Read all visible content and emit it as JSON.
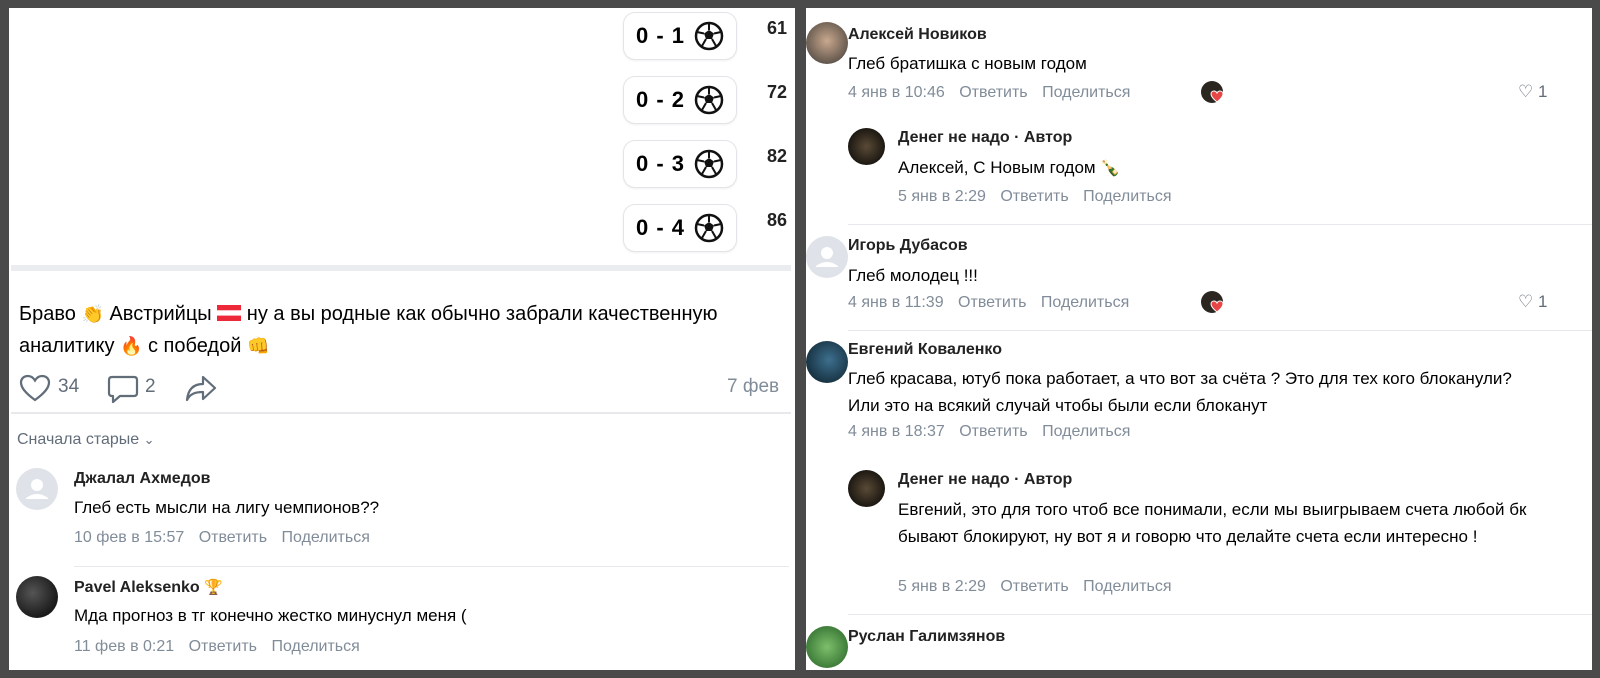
{
  "scores": [
    {
      "score": "0 - 1",
      "pct": "61"
    },
    {
      "score": "0 - 2",
      "pct": "72"
    },
    {
      "score": "0 - 3",
      "pct": "82"
    },
    {
      "score": "0 - 4",
      "pct": "86"
    }
  ],
  "post": {
    "text_part1": "Браво",
    "text_part2": "Австрийцы",
    "text_part3": "ну а вы родные как обычно забрали качественную",
    "text_part4": "аналитику",
    "text_part5": "с победой",
    "likes": "34",
    "comments": "2",
    "date": "7 фев"
  },
  "sort": {
    "label": "Сначала старые"
  },
  "left_comments": [
    {
      "name": "Джалал Ахмедов",
      "text": "Глеб есть мысли на лигу чемпионов??",
      "date": "10 фев в 15:57",
      "reply": "Ответить",
      "share": "Поделиться"
    },
    {
      "name": "Pavel Aleksenko",
      "text": "Мда прогноз в тг конечно жестко минуснул меня (",
      "date": "11 фев в 0:21",
      "reply": "Ответить",
      "share": "Поделиться"
    }
  ],
  "right_comments": [
    {
      "name": "Алексей Новиков",
      "text": "Глеб братишка с новым годом",
      "date": "4 янв в 10:46",
      "reply": "Ответить",
      "share": "Поделиться",
      "likes": "1"
    },
    {
      "name": "Денег не надо · Автор",
      "text": "Алексей, С Новым годом",
      "date": "5 янв в 2:29",
      "reply": "Ответить",
      "share": "Поделиться"
    },
    {
      "name": "Игорь Дубасов",
      "text": "Глеб молодец !!!",
      "date": "4 янв в 11:39",
      "reply": "Ответить",
      "share": "Поделиться",
      "likes": "1"
    },
    {
      "name": "Евгений Коваленко",
      "text": "Глеб красава, ютуб пока работает, а что вот за счёта ? Это для тех кого блоканули? Или это на всякий случай чтобы были если блоканут",
      "date": "4 янв в 18:37",
      "reply": "Ответить",
      "share": "Поделиться"
    },
    {
      "name": "Денег не надо · Автор",
      "text": "Евгений, это для того чтоб все понимали, если мы выигрываем счета любой бк бывают блокируют, ну вот я и говорю что делайте счета если интересно !",
      "date": "5 янв в 2:29",
      "reply": "Ответить",
      "share": "Поделиться"
    },
    {
      "name": "Руслан Галимзянов"
    }
  ],
  "colors": {
    "meta": "#818c99",
    "accent_heart": "#e64646",
    "divider": "#ebecef"
  }
}
